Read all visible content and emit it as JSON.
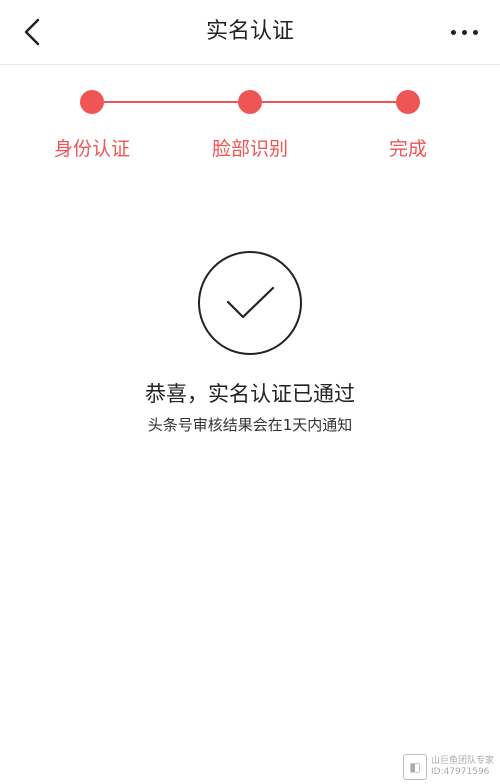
{
  "header": {
    "title": "实名认证"
  },
  "steps": [
    {
      "label": "身份认证"
    },
    {
      "label": "脸部识别"
    },
    {
      "label": "完成"
    }
  ],
  "result": {
    "title": "恭喜，实名认证已通过",
    "subtitle": "头条号审核结果会在1天内通知"
  },
  "watermark": {
    "line1": "山巨鱼团队专家",
    "line2": "ID:47971596"
  },
  "colors": {
    "accent": "#f05555",
    "text": "#222222"
  }
}
